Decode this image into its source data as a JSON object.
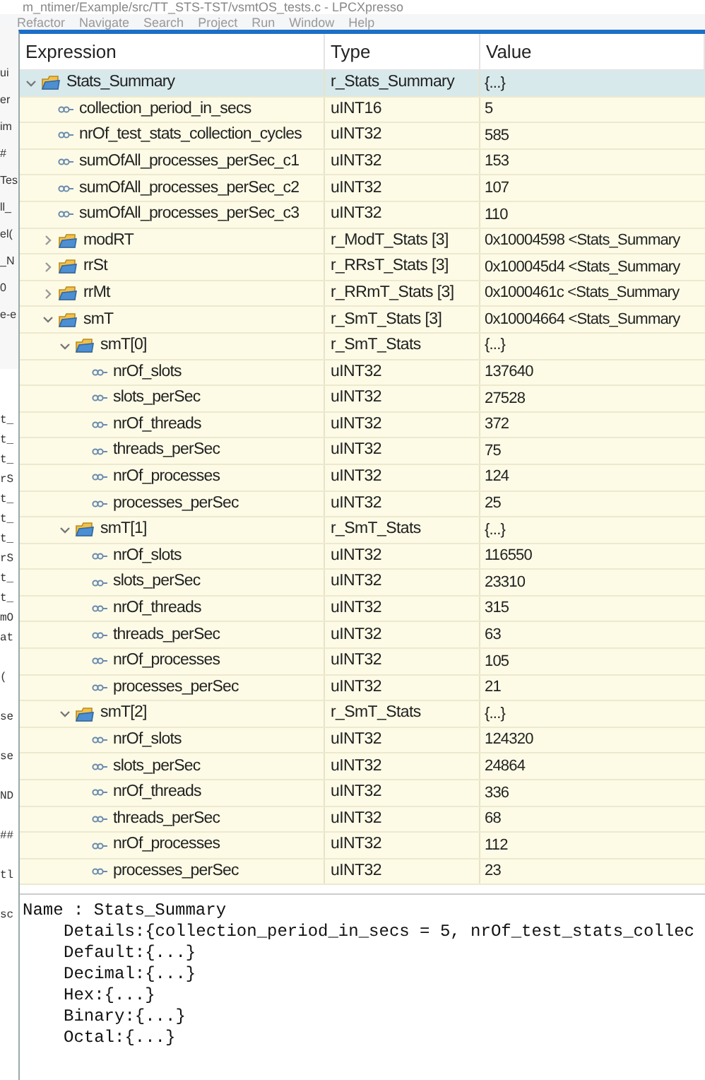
{
  "background_window": {
    "title": "m_ntimer/Example/src/TT_STS-TST/vsmtOS_tests.c - LPCXpresso",
    "menu": [
      "Refactor",
      "Navigate",
      "Search",
      "Project",
      "Run",
      "Window",
      "Help"
    ],
    "side_fragments": [
      "ui",
      "er",
      "im",
      "#",
      "Tes",
      "ll_",
      "el(",
      "_N",
      "0",
      "e-e"
    ],
    "code_fragments": [
      "t_",
      "t_",
      "t_",
      "rS",
      "t_",
      "t_",
      "t_",
      "rS",
      "t_",
      "t_",
      "mO",
      "at",
      "(",
      "se",
      "se",
      "ND",
      "##",
      "tl",
      "sc"
    ]
  },
  "expressions": {
    "columns": [
      "Expression",
      "Type",
      "Value"
    ],
    "rows": [
      {
        "kind": "struct",
        "name": "Stats_Summary",
        "type": "r_Stats_Summary",
        "value": "{...}",
        "expanded": true,
        "selected": true,
        "children": [
          {
            "kind": "field",
            "name": "collection_period_in_secs",
            "type": "uINT16",
            "value": "5",
            "selected": false
          },
          {
            "kind": "field",
            "name": "nrOf_test_stats_collection_cycles",
            "type": "uINT32",
            "value": "585",
            "selected": false
          },
          {
            "kind": "field",
            "name": "sumOfAll_processes_perSec_c1",
            "type": "uINT32",
            "value": "153",
            "selected": false
          },
          {
            "kind": "field",
            "name": "sumOfAll_processes_perSec_c2",
            "type": "uINT32",
            "value": "107",
            "selected": false
          },
          {
            "kind": "field",
            "name": "sumOfAll_processes_perSec_c3",
            "type": "uINT32",
            "value": "110",
            "selected": false
          },
          {
            "kind": "struct",
            "name": "modRT",
            "type": "r_ModT_Stats [3]",
            "value": "0x10004598 <Stats_Summary",
            "expanded": false,
            "selected": false
          },
          {
            "kind": "struct",
            "name": "rrSt",
            "type": "r_RRsT_Stats [3]",
            "value": "0x100045d4 <Stats_Summary",
            "expanded": false,
            "selected": false
          },
          {
            "kind": "struct",
            "name": "rrMt",
            "type": "r_RRmT_Stats [3]",
            "value": "0x1000461c <Stats_Summary",
            "expanded": false,
            "selected": false
          },
          {
            "kind": "struct",
            "name": "smT",
            "type": "r_SmT_Stats [3]",
            "value": "0x10004664 <Stats_Summary",
            "expanded": true,
            "selected": false,
            "children": [
              {
                "kind": "struct",
                "name": "smT[0]",
                "type": "r_SmT_Stats",
                "value": "{...}",
                "expanded": true,
                "selected": false,
                "children": [
                  {
                    "kind": "field",
                    "name": "nrOf_slots",
                    "type": "uINT32",
                    "value": "137640",
                    "selected": false
                  },
                  {
                    "kind": "field",
                    "name": "slots_perSec",
                    "type": "uINT32",
                    "value": "27528",
                    "selected": false
                  },
                  {
                    "kind": "field",
                    "name": "nrOf_threads",
                    "type": "uINT32",
                    "value": "372",
                    "selected": false
                  },
                  {
                    "kind": "field",
                    "name": "threads_perSec",
                    "type": "uINT32",
                    "value": "75",
                    "selected": false
                  },
                  {
                    "kind": "field",
                    "name": "nrOf_processes",
                    "type": "uINT32",
                    "value": "124",
                    "selected": false
                  },
                  {
                    "kind": "field",
                    "name": "processes_perSec",
                    "type": "uINT32",
                    "value": "25",
                    "selected": false
                  }
                ]
              },
              {
                "kind": "struct",
                "name": "smT[1]",
                "type": "r_SmT_Stats",
                "value": "{...}",
                "expanded": true,
                "selected": false,
                "children": [
                  {
                    "kind": "field",
                    "name": "nrOf_slots",
                    "type": "uINT32",
                    "value": "116550",
                    "selected": false
                  },
                  {
                    "kind": "field",
                    "name": "slots_perSec",
                    "type": "uINT32",
                    "value": "23310",
                    "selected": false
                  },
                  {
                    "kind": "field",
                    "name": "nrOf_threads",
                    "type": "uINT32",
                    "value": "315",
                    "selected": false
                  },
                  {
                    "kind": "field",
                    "name": "threads_perSec",
                    "type": "uINT32",
                    "value": "63",
                    "selected": false
                  },
                  {
                    "kind": "field",
                    "name": "nrOf_processes",
                    "type": "uINT32",
                    "value": "105",
                    "selected": false
                  },
                  {
                    "kind": "field",
                    "name": "processes_perSec",
                    "type": "uINT32",
                    "value": "21",
                    "selected": false
                  }
                ]
              },
              {
                "kind": "struct",
                "name": "smT[2]",
                "type": "r_SmT_Stats",
                "value": "{...}",
                "expanded": true,
                "selected": false,
                "children": [
                  {
                    "kind": "field",
                    "name": "nrOf_slots",
                    "type": "uINT32",
                    "value": "124320",
                    "selected": false
                  },
                  {
                    "kind": "field",
                    "name": "slots_perSec",
                    "type": "uINT32",
                    "value": "24864",
                    "selected": false
                  },
                  {
                    "kind": "field",
                    "name": "nrOf_threads",
                    "type": "uINT32",
                    "value": "336",
                    "selected": false
                  },
                  {
                    "kind": "field",
                    "name": "threads_perSec",
                    "type": "uINT32",
                    "value": "68",
                    "selected": false
                  },
                  {
                    "kind": "field",
                    "name": "nrOf_processes",
                    "type": "uINT32",
                    "value": "112",
                    "selected": false
                  },
                  {
                    "kind": "field",
                    "name": "processes_perSec",
                    "type": "uINT32",
                    "value": "23",
                    "selected": false
                  }
                ]
              }
            ]
          }
        ]
      }
    ]
  },
  "details": {
    "name_line": "Name : Stats_Summary",
    "lines": [
      "Details:{collection_period_in_secs = 5, nrOf_test_stats_collec",
      "Default:{...}",
      "Decimal:{...}",
      "Hex:{...}",
      "Binary:{...}",
      "Octal:{...}"
    ]
  }
}
